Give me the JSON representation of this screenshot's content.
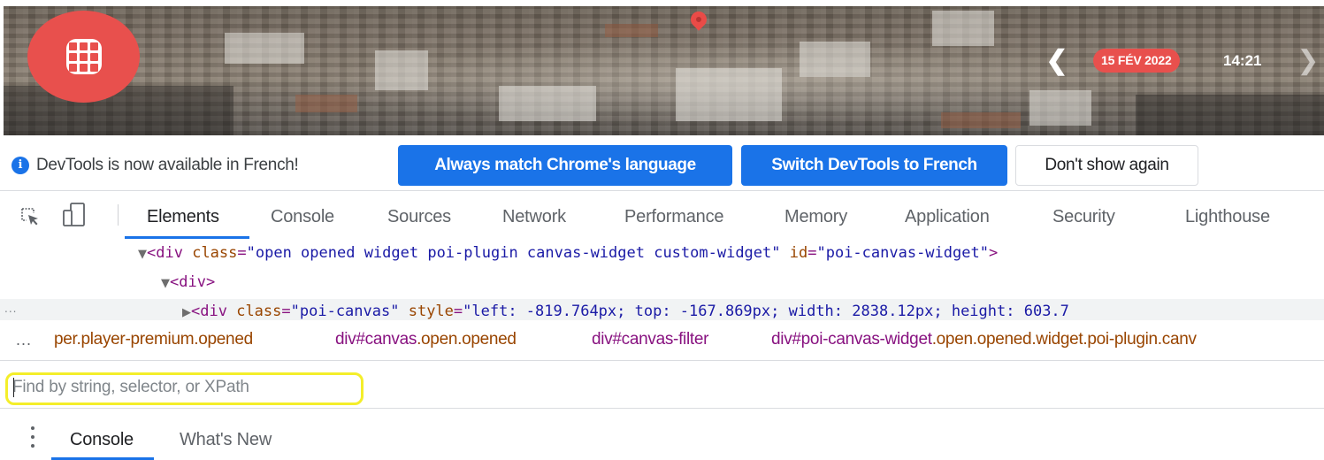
{
  "page": {
    "logo_icon": "grid-logo-icon",
    "map_pin_icon": "map-pin-icon",
    "prev_icon": "chevron-left-icon",
    "prev_glyph": "❮",
    "date": "15 FÉV 2022",
    "time": "14:21",
    "next_icon": "chevron-right-icon",
    "next_glyph": "❯",
    "accent_color": "#e8504d"
  },
  "infobar": {
    "icon": "info-icon",
    "icon_glyph": "i",
    "message": "DevTools is now available in French!",
    "match_button": "Always match Chrome's language",
    "switch_button": "Switch DevTools to French",
    "dismiss_button": "Don't show again"
  },
  "toolbar": {
    "inspect_icon": "inspect-element-icon",
    "device_icon": "device-toolbar-icon",
    "tabs": [
      {
        "label": "Elements",
        "active": true
      },
      {
        "label": "Console",
        "active": false
      },
      {
        "label": "Sources",
        "active": false
      },
      {
        "label": "Network",
        "active": false
      },
      {
        "label": "Performance",
        "active": false
      },
      {
        "label": "Memory",
        "active": false
      },
      {
        "label": "Application",
        "active": false
      },
      {
        "label": "Security",
        "active": false
      },
      {
        "label": "Lighthouse",
        "active": false
      }
    ]
  },
  "dom": {
    "line1": {
      "tag_open": "<div",
      "attr1": "class",
      "val1": "\"open opened widget poi-plugin canvas-widget custom-widget\"",
      "attr2": "id",
      "val2": "\"poi-canvas-widget\"",
      "tag_close": ">"
    },
    "line2": {
      "tag": "<div>"
    },
    "line3": {
      "tag_open": "<div",
      "attr1": "class",
      "val1": "\"poi-canvas\"",
      "attr2": "style",
      "val2": "\"left: -819.764px; top: -167.869px; width: 2838.12px; height: 603.7"
    },
    "gutter_dots": "..."
  },
  "breadcrumbs": {
    "more": "...",
    "items": [
      {
        "tag": "",
        "classes": "per.player-premium.opened"
      },
      {
        "tag": "div#canvas",
        "classes": ".open.opened"
      },
      {
        "tag": "div#canvas-filter",
        "classes": ""
      },
      {
        "tag": "div#poi-canvas-widget",
        "classes": ".open.opened.widget.poi-plugin.canv"
      }
    ]
  },
  "find": {
    "placeholder": "Find by string, selector, or XPath",
    "value": "",
    "highlight_color": "#f4ee2a"
  },
  "drawer": {
    "menu_icon": "kebab-menu-icon",
    "tabs": [
      {
        "label": "Console",
        "active": true
      },
      {
        "label": "What's New",
        "active": false
      }
    ]
  }
}
